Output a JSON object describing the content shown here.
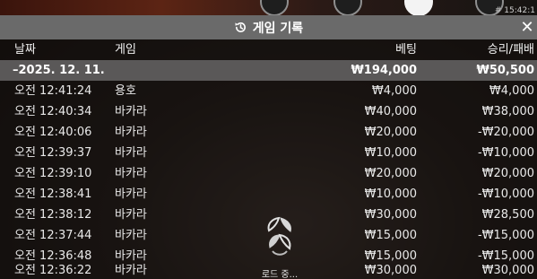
{
  "top_bar": {
    "clock": "# 15:42:1"
  },
  "panel": {
    "title": "게임 기록",
    "close_glyph": "✕",
    "icon": "history-icon"
  },
  "columns": {
    "date": "날짜",
    "game": "게임",
    "bet": "베팅",
    "result": "승리/패배"
  },
  "summary": {
    "date": "–2025. 12. 11.",
    "bet": "₩194,000",
    "result": "₩50,500"
  },
  "rows": [
    {
      "time": "오전 12:41:24",
      "game": "용호",
      "bet": "₩4,000",
      "result": "₩4,000"
    },
    {
      "time": "오전 12:40:34",
      "game": "바카라",
      "bet": "₩40,000",
      "result": "₩38,000"
    },
    {
      "time": "오전 12:40:06",
      "game": "바카라",
      "bet": "₩20,000",
      "result": "-₩20,000"
    },
    {
      "time": "오전 12:39:37",
      "game": "바카라",
      "bet": "₩10,000",
      "result": "-₩10,000"
    },
    {
      "time": "오전 12:39:10",
      "game": "바카라",
      "bet": "₩20,000",
      "result": "₩20,000"
    },
    {
      "time": "오전 12:38:41",
      "game": "바카라",
      "bet": "₩10,000",
      "result": "-₩10,000"
    },
    {
      "time": "오전 12:38:12",
      "game": "바카라",
      "bet": "₩30,000",
      "result": "₩28,500"
    },
    {
      "time": "오전 12:37:44",
      "game": "바카라",
      "bet": "₩15,000",
      "result": "-₩15,000"
    },
    {
      "time": "오전 12:36:48",
      "game": "바카라",
      "bet": "₩15,000",
      "result": "-₩15,000"
    },
    {
      "time": "오전 12:36:22",
      "game": "바카라",
      "bet": "₩30,000",
      "result": "₩30,000"
    }
  ],
  "loading": {
    "text": "로드 중...",
    "icon": "spinner-icon"
  },
  "colors": {
    "header_bg": "#6a6a6a",
    "summary_bg": "#5a5858",
    "text": "#ffffff"
  }
}
